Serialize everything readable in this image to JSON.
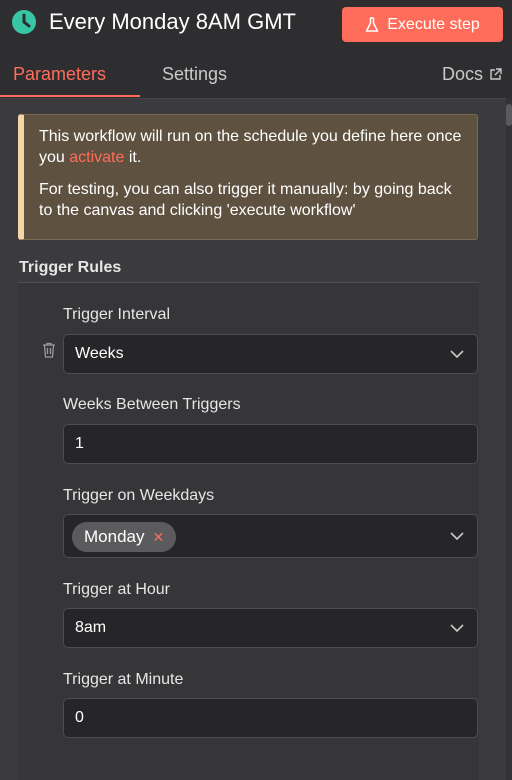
{
  "header": {
    "title": "Every Monday 8AM GMT",
    "execute_label": "Execute step"
  },
  "tabs": {
    "parameters": "Parameters",
    "settings": "Settings",
    "docs": "Docs"
  },
  "notice": {
    "line1_before": "This workflow will run on the schedule you define here once you ",
    "activate_link": "activate",
    "line1_after": " it.",
    "line2": "For testing, you can also trigger it manually: by going back to the canvas and clicking 'execute workflow'"
  },
  "trigger_rules": {
    "title": "Trigger Rules",
    "interval_label": "Trigger Interval",
    "interval_value": "Weeks",
    "weeks_between_label": "Weeks Between Triggers",
    "weeks_between_value": "1",
    "weekdays_label": "Trigger on Weekdays",
    "weekday_chip": "Monday",
    "hour_label": "Trigger at Hour",
    "hour_value": "8am",
    "minute_label": "Trigger at Minute",
    "minute_value": "0"
  },
  "colors": {
    "accent": "#ff6d5a",
    "title_icon": "#37c6a5",
    "notice_bg": "#5e5140"
  },
  "icons": {
    "title": "clock-icon",
    "execute": "flask-icon",
    "docs": "external-link-icon",
    "delete": "trash-icon",
    "dropdown": "chevron-down-icon",
    "chip_remove": "close-icon"
  }
}
